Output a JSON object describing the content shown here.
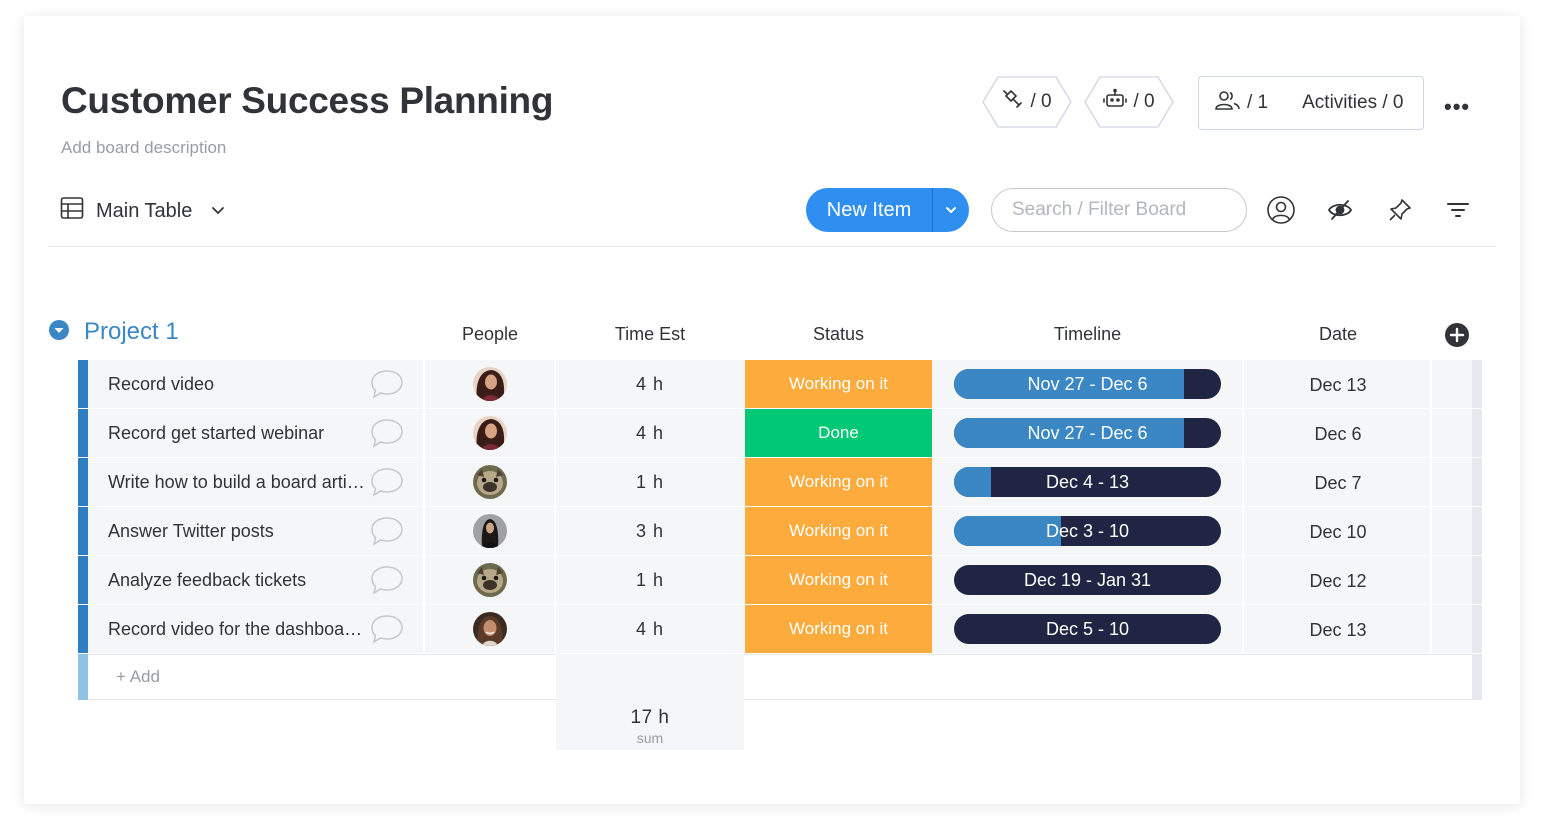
{
  "board": {
    "title": "Customer Success Planning",
    "description": "Add board description"
  },
  "header_buttons": {
    "integrations_count": "/ 0",
    "automations_count": "/ 0",
    "members_count": "/ 1",
    "activities_label": "Activities / 0",
    "more_label": "•••"
  },
  "toolbar": {
    "view_label": "Main Table",
    "new_item_label": "New Item",
    "search_placeholder": "Search / Filter Board"
  },
  "group": {
    "title": "Project 1",
    "columns": [
      "People",
      "Time Est",
      "Status",
      "Timeline",
      "Date"
    ],
    "add_label": "+ Add",
    "items": [
      {
        "name": "Record video",
        "avatar": "woman-curly-hair",
        "time": "4 h",
        "status": "Working on it",
        "status_color": "#fdab3d",
        "timeline": "Nov 27 - Dec 6",
        "timeline_progress": 0.86,
        "date": "Dec 13"
      },
      {
        "name": "Record get started webinar",
        "avatar": "woman-curly-hair",
        "time": "4 h",
        "status": "Done",
        "status_color": "#00c875",
        "timeline": "Nov 27 - Dec 6",
        "timeline_progress": 0.86,
        "date": "Dec 6"
      },
      {
        "name": "Write how to build a board artic...",
        "avatar": "dog",
        "time": "1 h",
        "status": "Working on it",
        "status_color": "#fdab3d",
        "timeline": "Dec 4 - 13",
        "timeline_progress": 0.14,
        "date": "Dec 7"
      },
      {
        "name": "Answer Twitter posts",
        "avatar": "woman-dark-hair",
        "time": "3 h",
        "status": "Working on it",
        "status_color": "#fdab3d",
        "timeline": "Dec 3 - 10",
        "timeline_progress": 0.4,
        "date": "Dec 10"
      },
      {
        "name": "Analyze feedback tickets",
        "avatar": "dog",
        "time": "1 h",
        "status": "Working on it",
        "status_color": "#fdab3d",
        "timeline": "Dec 19 - Jan 31",
        "timeline_progress": 0,
        "date": "Dec 12"
      },
      {
        "name": "Record video for the dashboards",
        "avatar": "woman-smiling",
        "time": "4 h",
        "status": "Working on it",
        "status_color": "#fdab3d",
        "timeline": "Dec 5 - 10",
        "timeline_progress": 0,
        "date": "Dec 13"
      }
    ],
    "summary": {
      "time_total": "17 h",
      "time_label": "sum"
    }
  },
  "colors": {
    "accent": "#0073ea",
    "new_item_button": "#2e8ff0",
    "group": "#3b86c4",
    "timeline_dark": "#1f2542",
    "timeline_fill": "#3a87c3",
    "working": "#fdab3d",
    "done": "#00c875"
  }
}
